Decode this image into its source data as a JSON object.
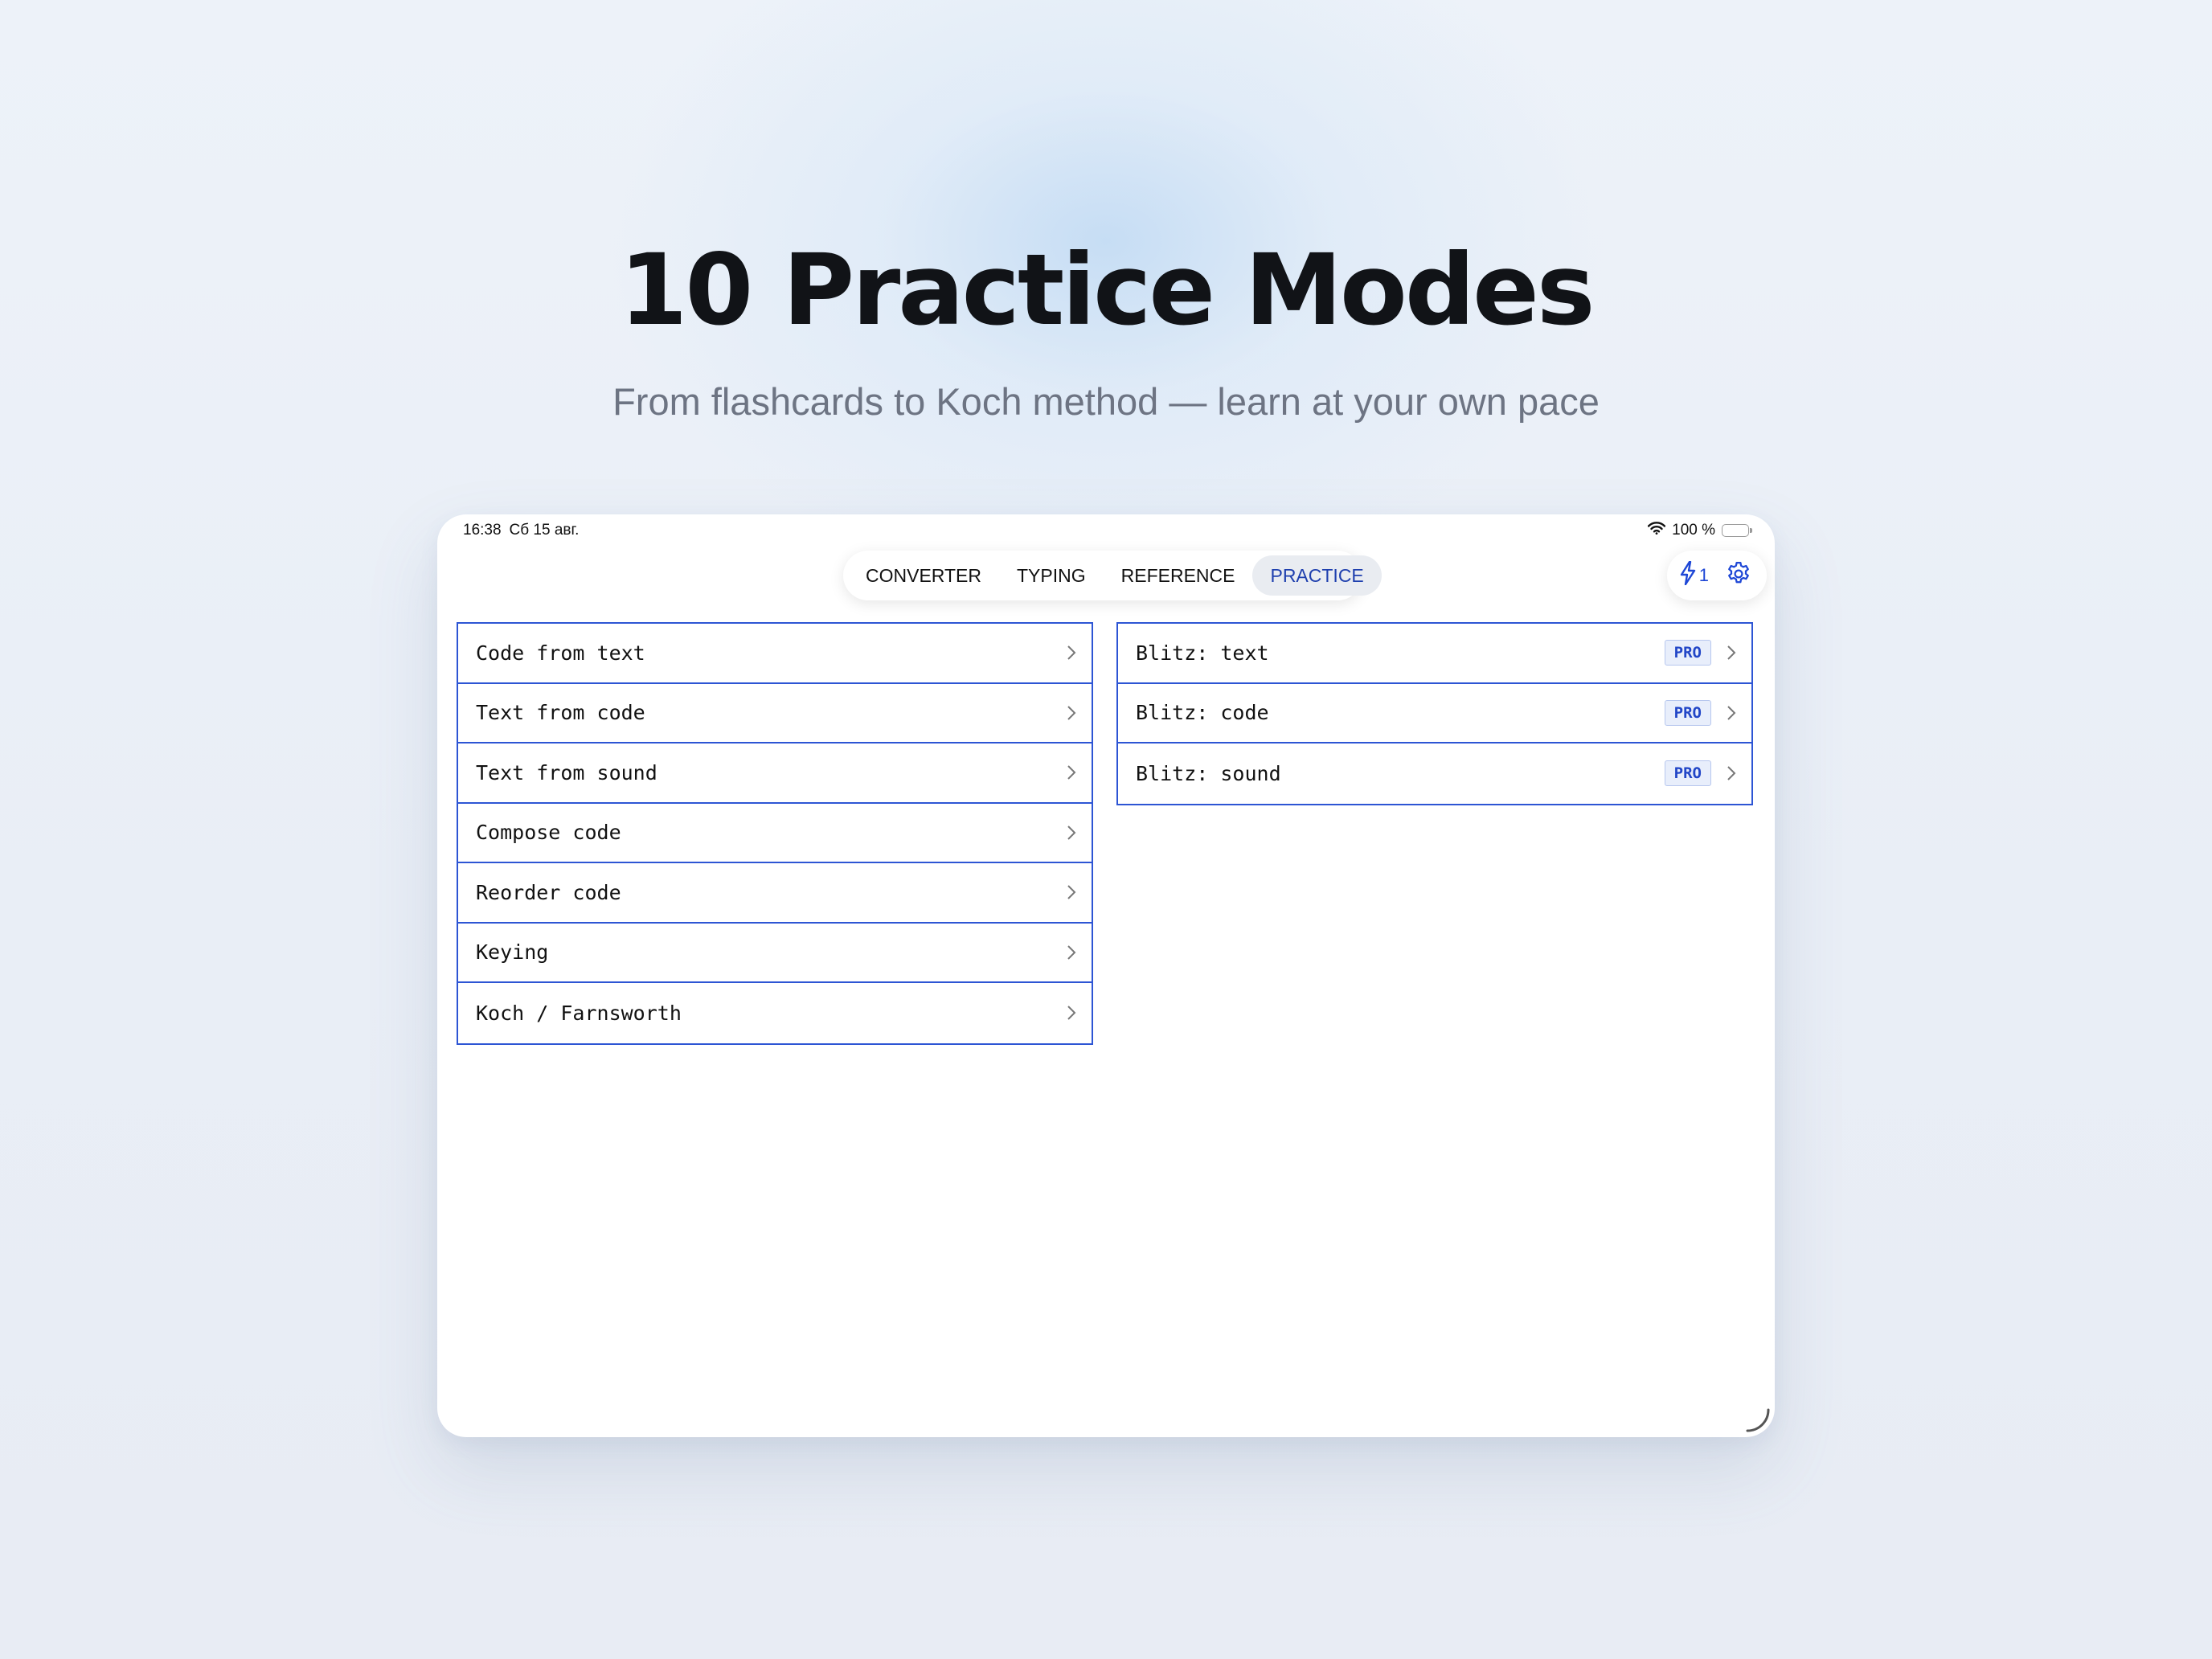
{
  "marketing": {
    "title": "10 Practice Modes",
    "subtitle": "From flashcards to Koch method — learn at your own pace"
  },
  "status_bar": {
    "time": "16:38",
    "date": "Сб 15 авг.",
    "battery": "100 %",
    "icons": [
      "wifi-icon",
      "battery-icon"
    ]
  },
  "tabs": [
    {
      "label": "CONVERTER",
      "active": false
    },
    {
      "label": "TYPING",
      "active": false
    },
    {
      "label": "REFERENCE",
      "active": false
    },
    {
      "label": "PRACTICE",
      "active": true
    }
  ],
  "top_actions": {
    "energy_count": "1",
    "icons": [
      "lightning-icon",
      "gear-icon"
    ]
  },
  "modes_left": [
    {
      "label": "Code from text"
    },
    {
      "label": "Text from code"
    },
    {
      "label": "Text from sound"
    },
    {
      "label": "Compose code"
    },
    {
      "label": "Reorder code"
    },
    {
      "label": "Keying"
    },
    {
      "label": "Koch / Farnsworth"
    }
  ],
  "modes_right": [
    {
      "label": "Blitz: text",
      "badge": "PRO"
    },
    {
      "label": "Blitz: code",
      "badge": "PRO"
    },
    {
      "label": "Blitz: sound",
      "badge": "PRO"
    }
  ],
  "colors": {
    "accent": "#2d55d4",
    "active_tab_text": "#1e3fae",
    "active_tab_bg": "#e9ecf1",
    "pro_badge_bg": "#e8eefb"
  }
}
